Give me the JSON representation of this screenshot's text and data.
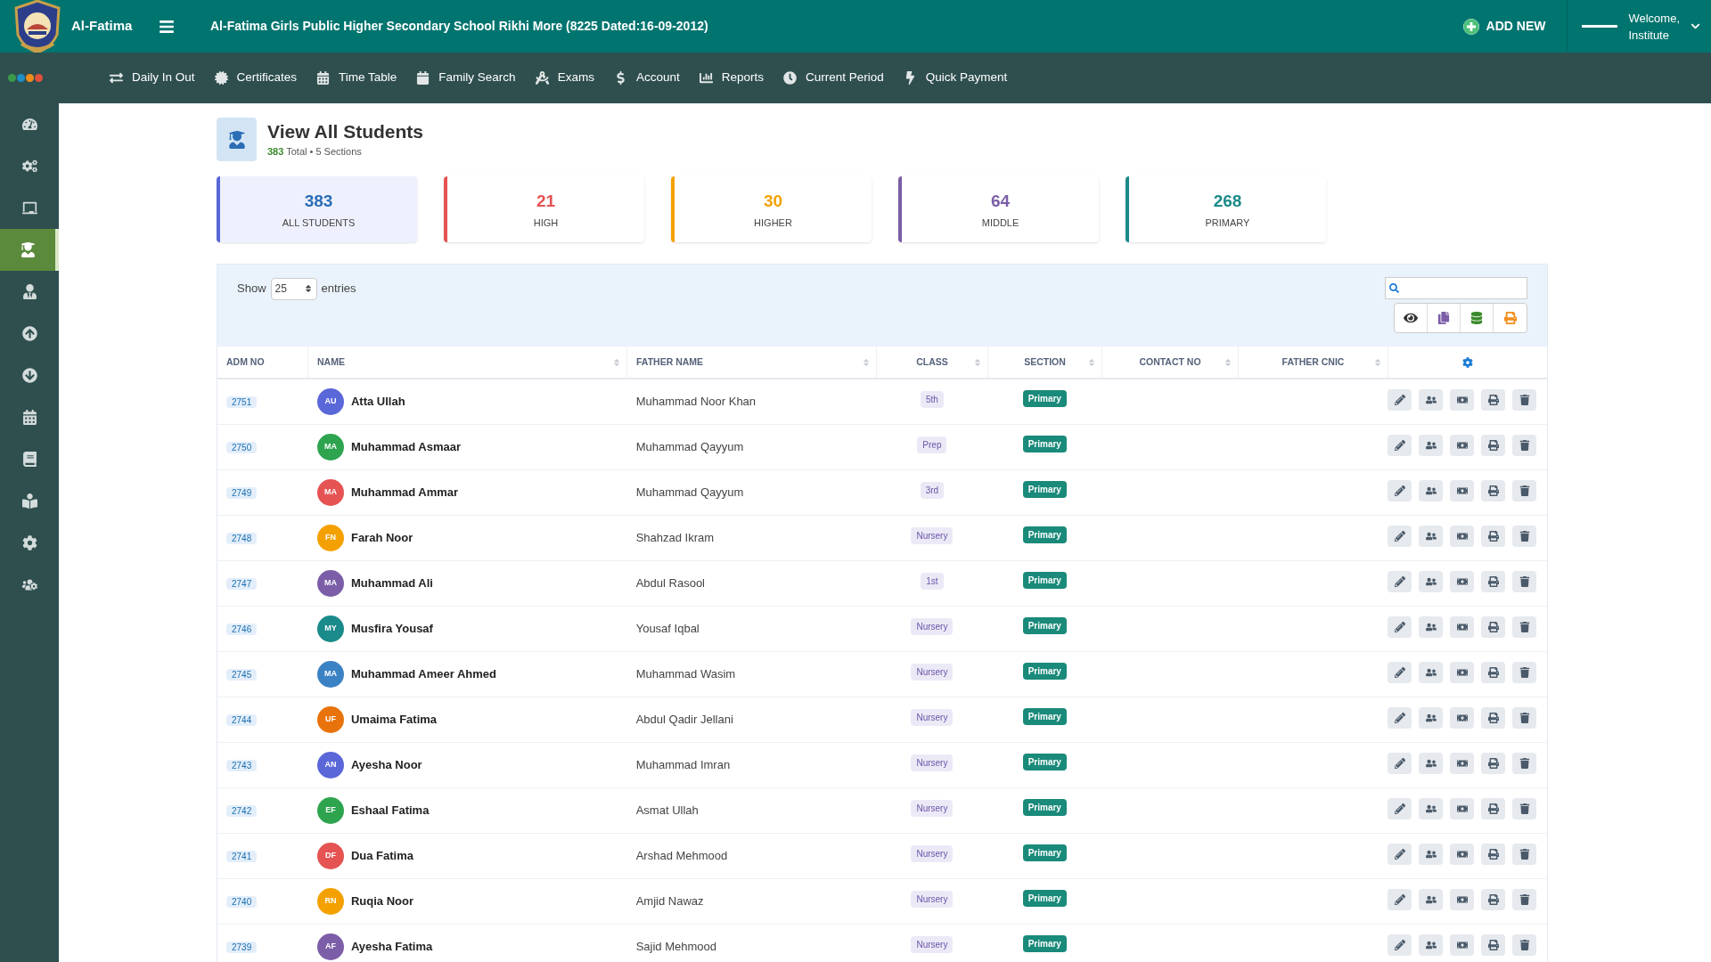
{
  "brand": {
    "name": "Al-Fatima"
  },
  "header": {
    "title": "Al-Fatima Girls Public Higher Secondary School Rikhi More (8225 Dated:16-09-2012)",
    "add_new": "ADD NEW",
    "welcome": "Welcome,",
    "user": "Institute"
  },
  "status_dots": [
    {
      "color": "#3a9a4a"
    },
    {
      "color": "#1f8fc4"
    },
    {
      "color": "#f28c1a"
    },
    {
      "color": "#e0503a"
    }
  ],
  "nav": [
    {
      "label": "Daily In Out"
    },
    {
      "label": "Certificates"
    },
    {
      "label": "Time Table"
    },
    {
      "label": "Family Search"
    },
    {
      "label": "Exams"
    },
    {
      "label": "Account"
    },
    {
      "label": "Reports"
    },
    {
      "label": "Current Period"
    },
    {
      "label": "Quick Payment"
    }
  ],
  "sidebar": {
    "items": [
      {
        "selected": false
      },
      {
        "selected": false
      },
      {
        "selected": false
      },
      {
        "selected": true
      },
      {
        "selected": false
      },
      {
        "selected": false
      },
      {
        "selected": false
      },
      {
        "selected": false
      },
      {
        "selected": false
      },
      {
        "selected": false
      },
      {
        "selected": false
      },
      {
        "selected": false
      }
    ]
  },
  "page": {
    "title": "View All Students",
    "total": "383",
    "subtitle": "Total • 5 Sections"
  },
  "stats": [
    {
      "value": "383",
      "label": "ALL STUDENTS",
      "color": "#5a67d8",
      "selected": true
    },
    {
      "value": "21",
      "label": "HIGH",
      "color": "#e55353",
      "selected": false
    },
    {
      "value": "30",
      "label": "HIGHER",
      "color": "#f4a100",
      "selected": false
    },
    {
      "value": "64",
      "label": "MIDDLE",
      "color": "#7b5ea7",
      "selected": false
    },
    {
      "value": "268",
      "label": "PRIMARY",
      "color": "#1a8a8a",
      "selected": false
    }
  ],
  "table": {
    "show_label": "Show",
    "page_size": "25",
    "entries_label": "entries",
    "columns": [
      "ADM NO",
      "NAME",
      "FATHER NAME",
      "CLASS",
      "SECTION",
      "CONTACT NO",
      "FATHER CNIC"
    ],
    "rows": [
      {
        "adm": "2751",
        "initials": "AU",
        "color": "#5a67d8",
        "name": "Atta Ullah",
        "father": "Muhammad Noor Khan",
        "class": "5th",
        "section": "Primary"
      },
      {
        "adm": "2750",
        "initials": "MA",
        "color": "#2ea44f",
        "name": "Muhammad Asmaar",
        "father": "Muhammad Qayyum",
        "class": "Prep",
        "section": "Primary"
      },
      {
        "adm": "2749",
        "initials": "MA",
        "color": "#e55353",
        "name": "Muhammad Ammar",
        "father": "Muhammad Qayyum",
        "class": "3rd",
        "section": "Primary"
      },
      {
        "adm": "2748",
        "initials": "FN",
        "color": "#f4a100",
        "name": "Farah Noor",
        "father": "Shahzad Ikram",
        "class": "Nursery",
        "section": "Primary"
      },
      {
        "adm": "2747",
        "initials": "MA",
        "color": "#7b5ea7",
        "name": "Muhammad Ali",
        "father": "Abdul Rasool",
        "class": "1st",
        "section": "Primary"
      },
      {
        "adm": "2746",
        "initials": "MY",
        "color": "#1a8a8a",
        "name": "Musfira Yousaf",
        "father": "Yousaf Iqbal",
        "class": "Nursery",
        "section": "Primary"
      },
      {
        "adm": "2745",
        "initials": "MA",
        "color": "#3b82c4",
        "name": "Muhammad Ameer Ahmed",
        "father": "Muhammad Wasim",
        "class": "Nursery",
        "section": "Primary"
      },
      {
        "adm": "2744",
        "initials": "UF",
        "color": "#e8730c",
        "name": "Umaima Fatima",
        "father": "Abdul Qadir Jellani",
        "class": "Nursery",
        "section": "Primary"
      },
      {
        "adm": "2743",
        "initials": "AN",
        "color": "#5a67d8",
        "name": "Ayesha Noor",
        "father": "Muhammad Imran",
        "class": "Nursery",
        "section": "Primary"
      },
      {
        "adm": "2742",
        "initials": "EF",
        "color": "#2ea44f",
        "name": "Eshaal Fatima",
        "father": "Asmat Ullah",
        "class": "Nursery",
        "section": "Primary"
      },
      {
        "adm": "2741",
        "initials": "DF",
        "color": "#e55353",
        "name": "Dua Fatima",
        "father": "Arshad Mehmood",
        "class": "Nursery",
        "section": "Primary"
      },
      {
        "adm": "2740",
        "initials": "RN",
        "color": "#f4a100",
        "name": "Ruqia Noor",
        "father": "Amjid Nawaz",
        "class": "Nursery",
        "section": "Primary"
      },
      {
        "adm": "2739",
        "initials": "AF",
        "color": "#7b5ea7",
        "name": "Ayesha Fatima",
        "father": "Sajid Mehmood",
        "class": "Nursery",
        "section": "Primary"
      }
    ]
  }
}
